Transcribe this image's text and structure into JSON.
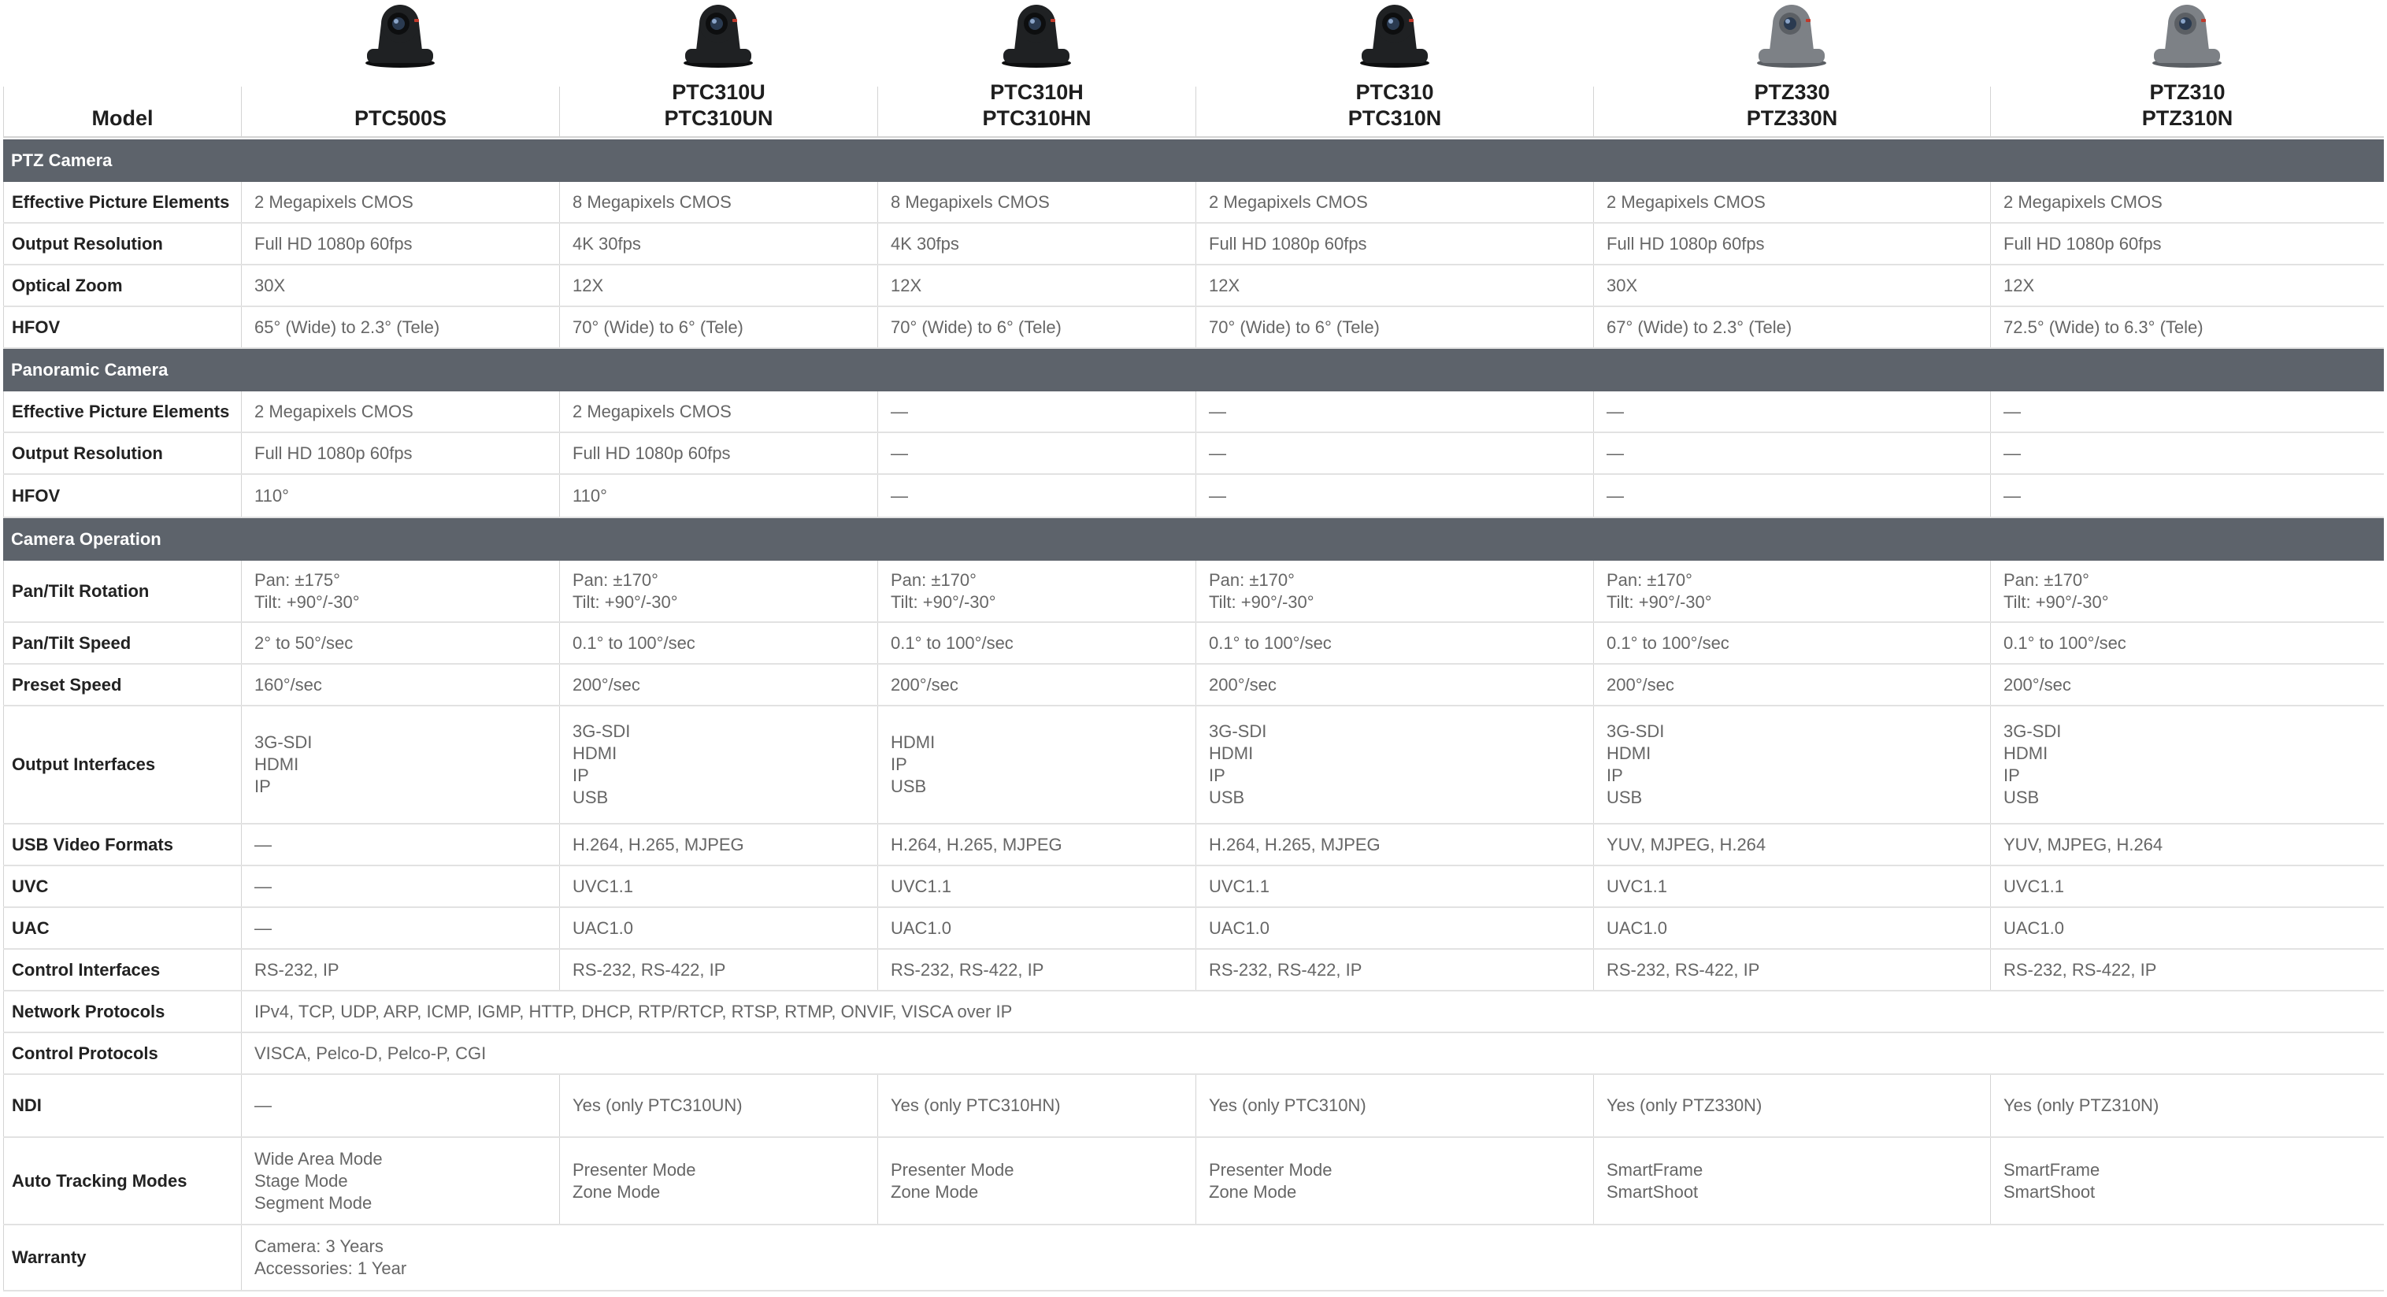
{
  "header": {
    "model_label": "Model",
    "models": [
      {
        "lines": [
          "PTC500S"
        ],
        "icon": "camera-black-icon"
      },
      {
        "lines": [
          "PTC310U",
          "PTC310UN"
        ],
        "icon": "camera-black-icon"
      },
      {
        "lines": [
          "PTC310H",
          "PTC310HN"
        ],
        "icon": "camera-black-icon"
      },
      {
        "lines": [
          "PTC310",
          "PTC310N"
        ],
        "icon": "camera-black-icon"
      },
      {
        "lines": [
          "PTZ330",
          "PTZ330N"
        ],
        "icon": "camera-gray-icon"
      },
      {
        "lines": [
          "PTZ310",
          "PTZ310N"
        ],
        "icon": "camera-gray-icon"
      }
    ]
  },
  "sections": [
    {
      "title": "PTZ Camera",
      "rows": [
        {
          "label": "Effective Picture Elements",
          "cells": [
            [
              "2 Megapixels CMOS"
            ],
            [
              "8 Megapixels CMOS"
            ],
            [
              "8 Megapixels CMOS"
            ],
            [
              "2 Megapixels CMOS"
            ],
            [
              "2 Megapixels CMOS"
            ],
            [
              "2 Megapixels CMOS"
            ]
          ]
        },
        {
          "label": "Output Resolution",
          "cells": [
            [
              "Full HD 1080p 60fps"
            ],
            [
              "4K 30fps"
            ],
            [
              "4K 30fps"
            ],
            [
              "Full HD 1080p 60fps"
            ],
            [
              "Full HD 1080p 60fps"
            ],
            [
              "Full HD 1080p 60fps"
            ]
          ]
        },
        {
          "label": "Optical Zoom",
          "cells": [
            [
              "30X"
            ],
            [
              "12X"
            ],
            [
              "12X"
            ],
            [
              "12X"
            ],
            [
              "30X"
            ],
            [
              "12X"
            ]
          ]
        },
        {
          "label": "HFOV",
          "cells": [
            [
              "65° (Wide) to 2.3° (Tele)"
            ],
            [
              "70° (Wide) to 6° (Tele)"
            ],
            [
              "70° (Wide) to 6° (Tele)"
            ],
            [
              "70° (Wide) to 6° (Tele)"
            ],
            [
              "67° (Wide) to 2.3° (Tele)"
            ],
            [
              "72.5° (Wide) to 6.3° (Tele)"
            ]
          ]
        }
      ]
    },
    {
      "title": "Panoramic Camera",
      "rows": [
        {
          "label": "Effective Picture Elements",
          "cells": [
            [
              "2 Megapixels CMOS"
            ],
            [
              "2 Megapixels CMOS"
            ],
            [
              "—"
            ],
            [
              "—"
            ],
            [
              "—"
            ],
            [
              "—"
            ]
          ]
        },
        {
          "label": "Output Resolution",
          "cells": [
            [
              "Full HD 1080p 60fps"
            ],
            [
              "Full HD 1080p 60fps"
            ],
            [
              "—"
            ],
            [
              "—"
            ],
            [
              "—"
            ],
            [
              "—"
            ]
          ]
        },
        {
          "label": "HFOV",
          "cells": [
            [
              "110°"
            ],
            [
              "110°"
            ],
            [
              "—"
            ],
            [
              "—"
            ],
            [
              "—"
            ],
            [
              "—"
            ]
          ]
        }
      ]
    },
    {
      "title": "Camera Operation",
      "rows": [
        {
          "label": "Pan/Tilt Rotation",
          "cells": [
            [
              "Pan: ±175°",
              "Tilt: +90°/-30°"
            ],
            [
              "Pan: ±170°",
              "Tilt: +90°/-30°"
            ],
            [
              "Pan: ±170°",
              "Tilt: +90°/-30°"
            ],
            [
              "Pan: ±170°",
              "Tilt: +90°/-30°"
            ],
            [
              "Pan: ±170°",
              "Tilt: +90°/-30°"
            ],
            [
              "Pan: ±170°",
              "Tilt: +90°/-30°"
            ]
          ]
        },
        {
          "label": "Pan/Tilt Speed",
          "cells": [
            [
              "2° to 50°/sec"
            ],
            [
              "0.1° to 100°/sec"
            ],
            [
              "0.1° to 100°/sec"
            ],
            [
              "0.1° to 100°/sec"
            ],
            [
              "0.1° to 100°/sec"
            ],
            [
              "0.1° to 100°/sec"
            ]
          ]
        },
        {
          "label": "Preset Speed",
          "cells": [
            [
              "160°/sec"
            ],
            [
              "200°/sec"
            ],
            [
              "200°/sec"
            ],
            [
              "200°/sec"
            ],
            [
              "200°/sec"
            ],
            [
              "200°/sec"
            ]
          ]
        },
        {
          "label": "Output Interfaces",
          "cells": [
            [
              "3G-SDI",
              "HDMI",
              "IP"
            ],
            [
              "3G-SDI",
              "HDMI",
              "IP",
              "USB"
            ],
            [
              "HDMI",
              "IP",
              "USB"
            ],
            [
              "3G-SDI",
              "HDMI",
              "IP",
              "USB"
            ],
            [
              "3G-SDI",
              "HDMI",
              "IP",
              "USB"
            ],
            [
              "3G-SDI",
              "HDMI",
              "IP",
              "USB"
            ]
          ]
        },
        {
          "label": "USB Video Formats",
          "cells": [
            [
              "—"
            ],
            [
              "H.264, H.265, MJPEG"
            ],
            [
              "H.264, H.265, MJPEG"
            ],
            [
              "H.264, H.265, MJPEG"
            ],
            [
              "YUV, MJPEG, H.264"
            ],
            [
              "YUV, MJPEG, H.264"
            ]
          ]
        },
        {
          "label": "UVC",
          "cells": [
            [
              "—"
            ],
            [
              "UVC1.1"
            ],
            [
              "UVC1.1"
            ],
            [
              "UVC1.1"
            ],
            [
              "UVC1.1"
            ],
            [
              "UVC1.1"
            ]
          ]
        },
        {
          "label": "UAC",
          "cells": [
            [
              "—"
            ],
            [
              "UAC1.0"
            ],
            [
              "UAC1.0"
            ],
            [
              "UAC1.0"
            ],
            [
              "UAC1.0"
            ],
            [
              "UAC1.0"
            ]
          ]
        },
        {
          "label": "Control Interfaces",
          "cells": [
            [
              "RS-232, IP"
            ],
            [
              "RS-232, RS-422, IP"
            ],
            [
              "RS-232, RS-422, IP"
            ],
            [
              "RS-232, RS-422, IP"
            ],
            [
              "RS-232, RS-422, IP"
            ],
            [
              "RS-232, RS-422, IP"
            ]
          ]
        },
        {
          "label": "Network Protocols",
          "merged": [
            "IPv4, TCP, UDP, ARP, ICMP, IGMP, HTTP, DHCP, RTP/RTCP, RTSP, RTMP, ONVIF, VISCA over IP"
          ]
        },
        {
          "label": "Control Protocols",
          "merged": [
            "VISCA, Pelco-D, Pelco-P, CGI"
          ]
        },
        {
          "label": "NDI",
          "cells": [
            [
              "—"
            ],
            [
              "Yes (only PTC310UN)"
            ],
            [
              "Yes (only PTC310HN)"
            ],
            [
              "Yes (only PTC310N)"
            ],
            [
              "Yes (only PTZ330N)"
            ],
            [
              "Yes (only PTZ310N)"
            ]
          ]
        },
        {
          "label": "Auto Tracking Modes",
          "cells": [
            [
              "Wide Area Mode",
              "Stage Mode",
              "Segment Mode"
            ],
            [
              "Presenter Mode",
              "Zone Mode"
            ],
            [
              "Presenter Mode",
              "Zone Mode"
            ],
            [
              "Presenter Mode",
              "Zone Mode"
            ],
            [
              "SmartFrame",
              "SmartShoot"
            ],
            [
              "SmartFrame",
              "SmartShoot"
            ]
          ]
        },
        {
          "label": "Warranty",
          "merged": [
            "Camera: 3 Years",
            "Accessories: 1 Year"
          ]
        }
      ]
    }
  ]
}
